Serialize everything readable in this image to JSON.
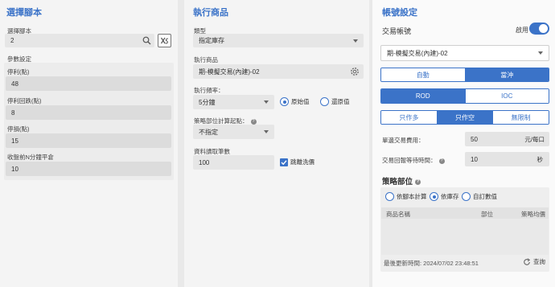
{
  "left": {
    "title": "選擇腳本",
    "script_label": "選擇腳本",
    "script_value": "2",
    "param_label": "參數設定",
    "params": [
      {
        "label": "停利(點)",
        "value": "48"
      },
      {
        "label": "停利回跌(點)",
        "value": "8"
      },
      {
        "label": "停損(點)",
        "value": "15"
      },
      {
        "label": "收盤前N分鐘平倉",
        "value": "10"
      }
    ]
  },
  "mid": {
    "title": "執行商品",
    "type_label": "類型",
    "type_value": "指定庫存",
    "product_label": "執行商品",
    "product_value": "期-模擬交易(內建)-02",
    "freq_label": "執行頻率：",
    "freq_value": "5分鐘",
    "freq_radio_1": "原始值",
    "freq_radio_2": "還原值",
    "start_label": "策略部位計算起點：",
    "start_value": "不指定",
    "data_label": "資料讀取筆數",
    "data_value": "100",
    "skip_label": "跳離洗價"
  },
  "right": {
    "title": "帳號設定",
    "account_label": "交易帳號",
    "enable_label": "啟用",
    "account_value": "期-模擬交易(內建)-02",
    "mode_options": [
      "自動",
      "當沖"
    ],
    "order_options": [
      "ROD",
      "IOC"
    ],
    "side_options": [
      "只作多",
      "只作空",
      "無限制"
    ],
    "fee_label": "單邊交易費用：",
    "fee_value": "50",
    "fee_unit": "元/每口",
    "wait_label": "交易回報等待時間：",
    "wait_value": "10",
    "wait_unit": "秒",
    "position_title": "策略部位",
    "position_radios": [
      "依腳本計算",
      "依庫存",
      "自訂數值"
    ],
    "table_headers": [
      "商品名稱",
      "部位",
      "策略均價"
    ],
    "updated_label": "最後更新時間: 2024/07/02 23:48:51",
    "refresh_label": "查詢"
  },
  "colors": {
    "accent": "#3b73c8"
  }
}
